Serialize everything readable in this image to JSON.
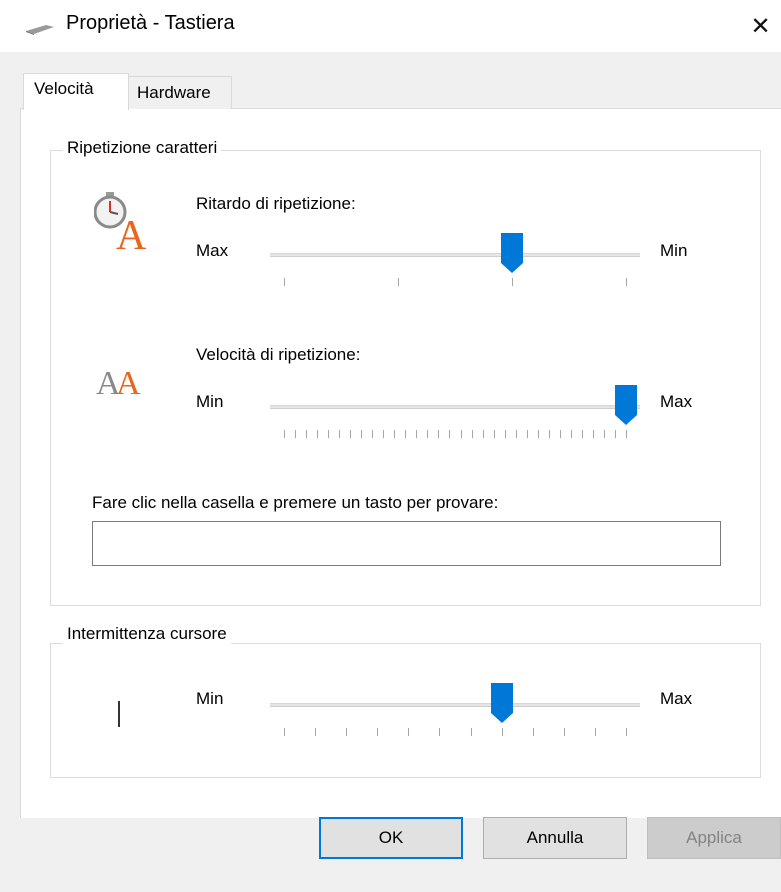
{
  "window": {
    "title": "Proprietà - Tastiera",
    "close_glyph": "✕",
    "icon": "keyboard-icon"
  },
  "tabs": [
    {
      "label": "Velocità",
      "active": true
    },
    {
      "label": "Hardware",
      "active": false
    }
  ],
  "char_repeat": {
    "group_label": "Ripetizione caratteri",
    "delay": {
      "label": "Ritardo di ripetizione:",
      "left_label": "Max",
      "right_label": "Min",
      "tick_count": 4,
      "position": 2,
      "icon": "stopwatch-letter-icon"
    },
    "rate": {
      "label": "Velocità di ripetizione:",
      "left_label": "Min",
      "right_label": "Max",
      "tick_count": 32,
      "position": 31,
      "icon": "double-letter-icon"
    },
    "test": {
      "label": "Fare clic nella casella e premere un tasto per provare:",
      "value": ""
    }
  },
  "cursor_blink": {
    "group_label": "Intermittenza cursore",
    "left_label": "Min",
    "right_label": "Max",
    "tick_count": 12,
    "position": 7,
    "icon": "text-cursor-icon"
  },
  "buttons": {
    "ok": "OK",
    "cancel": "Annulla",
    "apply": "Applica"
  },
  "colors": {
    "accent": "#0078d7",
    "icon_orange": "#e8651b",
    "icon_gray": "#8a8a8a"
  }
}
